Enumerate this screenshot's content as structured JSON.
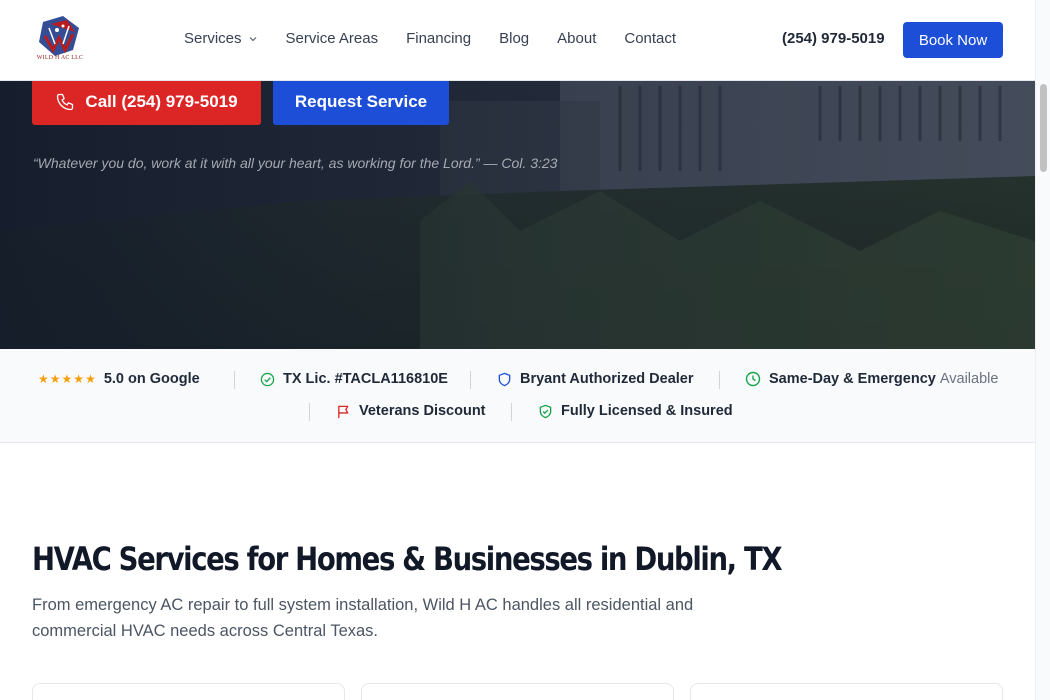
{
  "header": {
    "logo_text": "WILD H AC LLC",
    "nav": [
      {
        "label": "Services",
        "has_dropdown": true
      },
      {
        "label": "Service Areas"
      },
      {
        "label": "Financing"
      },
      {
        "label": "Blog"
      },
      {
        "label": "About"
      },
      {
        "label": "Contact"
      }
    ],
    "phone": "(254) 979-5019",
    "book_label": "Book Now"
  },
  "hero": {
    "call_label": "Call (254) 979-5019",
    "request_label": "Request Service",
    "quote": "“Whatever you do, work at it with all your heart, as working for the Lord.” — Col. 3:23"
  },
  "trust": {
    "rating": "5.0 on Google",
    "license": "TX Lic. #TACLA116810E",
    "dealer": "Bryant Authorized Dealer",
    "emergency": "Same-Day & Emergency",
    "emergency_suffix": "Available",
    "veterans": "Veterans Discount",
    "insured": "Fully Licensed & Insured"
  },
  "services": {
    "title": "HVAC Services for Homes & Businesses in Dublin, TX",
    "description": "From emergency AC repair to full system installation, Wild H AC handles all residential and commercial HVAC needs across Central Texas."
  },
  "colors": {
    "primary": "#1d4ed8",
    "accent_red": "#dc2626",
    "star": "#f59e0b",
    "check_green": "#16a34a"
  }
}
